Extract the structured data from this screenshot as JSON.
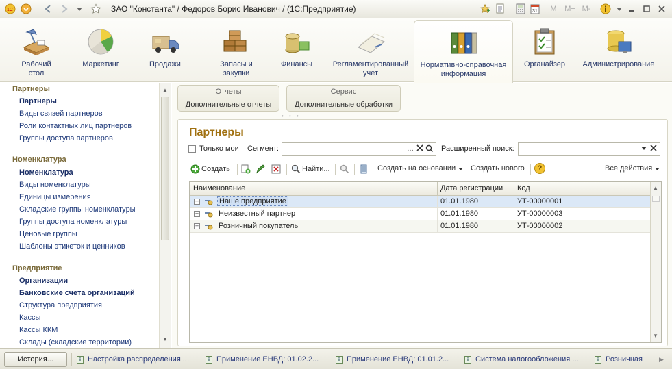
{
  "window": {
    "title": "ЗАО \"Константа\" / Федоров Борис Иванович / (1С:Предприятие)",
    "calc_labels": [
      "M",
      "M+",
      "M-"
    ]
  },
  "sections": [
    {
      "label": "Рабочий\nстол",
      "icon": "desk-lamp-icon"
    },
    {
      "label": "Маркетинг",
      "icon": "pie-chart-icon"
    },
    {
      "label": "Продажи",
      "icon": "truck-icon"
    },
    {
      "label": "Запасы и\nзакупки",
      "icon": "boxes-icon"
    },
    {
      "label": "Финансы",
      "icon": "coins-icon"
    },
    {
      "label": "Регламентированный\nучет",
      "icon": "documents-icon"
    },
    {
      "label": "Нормативно-справочная\nинформация",
      "icon": "folders-icon",
      "active": true
    },
    {
      "label": "Органайзер",
      "icon": "clipboard-icon"
    },
    {
      "label": "Администрирование",
      "icon": "database-icon"
    }
  ],
  "nav": {
    "groups": [
      {
        "title": "Партнеры",
        "items": [
          {
            "label": "Партнеры",
            "bold": true
          },
          {
            "label": "Виды связей партнеров"
          },
          {
            "label": "Роли контактных лиц партнеров"
          },
          {
            "label": "Группы доступа партнеров"
          }
        ]
      },
      {
        "title": "Номенклатура",
        "items": [
          {
            "label": "Номенклатура",
            "bold": true
          },
          {
            "label": "Виды номенклатуры"
          },
          {
            "label": "Единицы измерения"
          },
          {
            "label": "Складские группы номенклатуры"
          },
          {
            "label": "Группы доступа номенклатуры"
          },
          {
            "label": "Ценовые группы"
          },
          {
            "label": "Шаблоны этикеток и ценников"
          }
        ]
      },
      {
        "title": "Предприятие",
        "items": [
          {
            "label": "Организации",
            "bold": true
          },
          {
            "label": "Банковские счета организаций",
            "bold": true
          },
          {
            "label": "Структура предприятия"
          },
          {
            "label": "Кассы"
          },
          {
            "label": "Кассы ККМ"
          },
          {
            "label": "Склады (складские территории)"
          }
        ]
      }
    ]
  },
  "actions": {
    "reports": {
      "header": "Отчеты",
      "button": "Дополнительные отчеты"
    },
    "service": {
      "header": "Сервис",
      "button": "Дополнительные обработки"
    }
  },
  "form": {
    "title": "Партнеры",
    "only_mine": "Только мои",
    "segment_label": "Сегмент:",
    "segment_value": "",
    "adv_search_label": "Расширенный поиск:",
    "adv_search_value": "",
    "toolbar": {
      "create": "Создать",
      "find": "Найти...",
      "create_based": "Создать на основании",
      "create_new": "Создать нового",
      "help": "?",
      "all_actions": "Все действия"
    },
    "columns": [
      "Наименование",
      "Дата регистрации",
      "Код"
    ],
    "rows": [
      {
        "name": "Наше предприятие",
        "date": "01.01.1980",
        "code": "УТ-00000001",
        "selected": true
      },
      {
        "name": "Неизвестный партнер",
        "date": "01.01.1980",
        "code": "УТ-00000003"
      },
      {
        "name": "Розничный покупатель",
        "date": "01.01.1980",
        "code": "УТ-00000002"
      }
    ]
  },
  "bottom": {
    "history": "История...",
    "tabs": [
      "Настройка распределения ...",
      "Применение ЕНВД: 01.02.2...",
      "Применение ЕНВД: 01.01.2...",
      "Система налогообложения ...",
      "Розничная"
    ]
  }
}
